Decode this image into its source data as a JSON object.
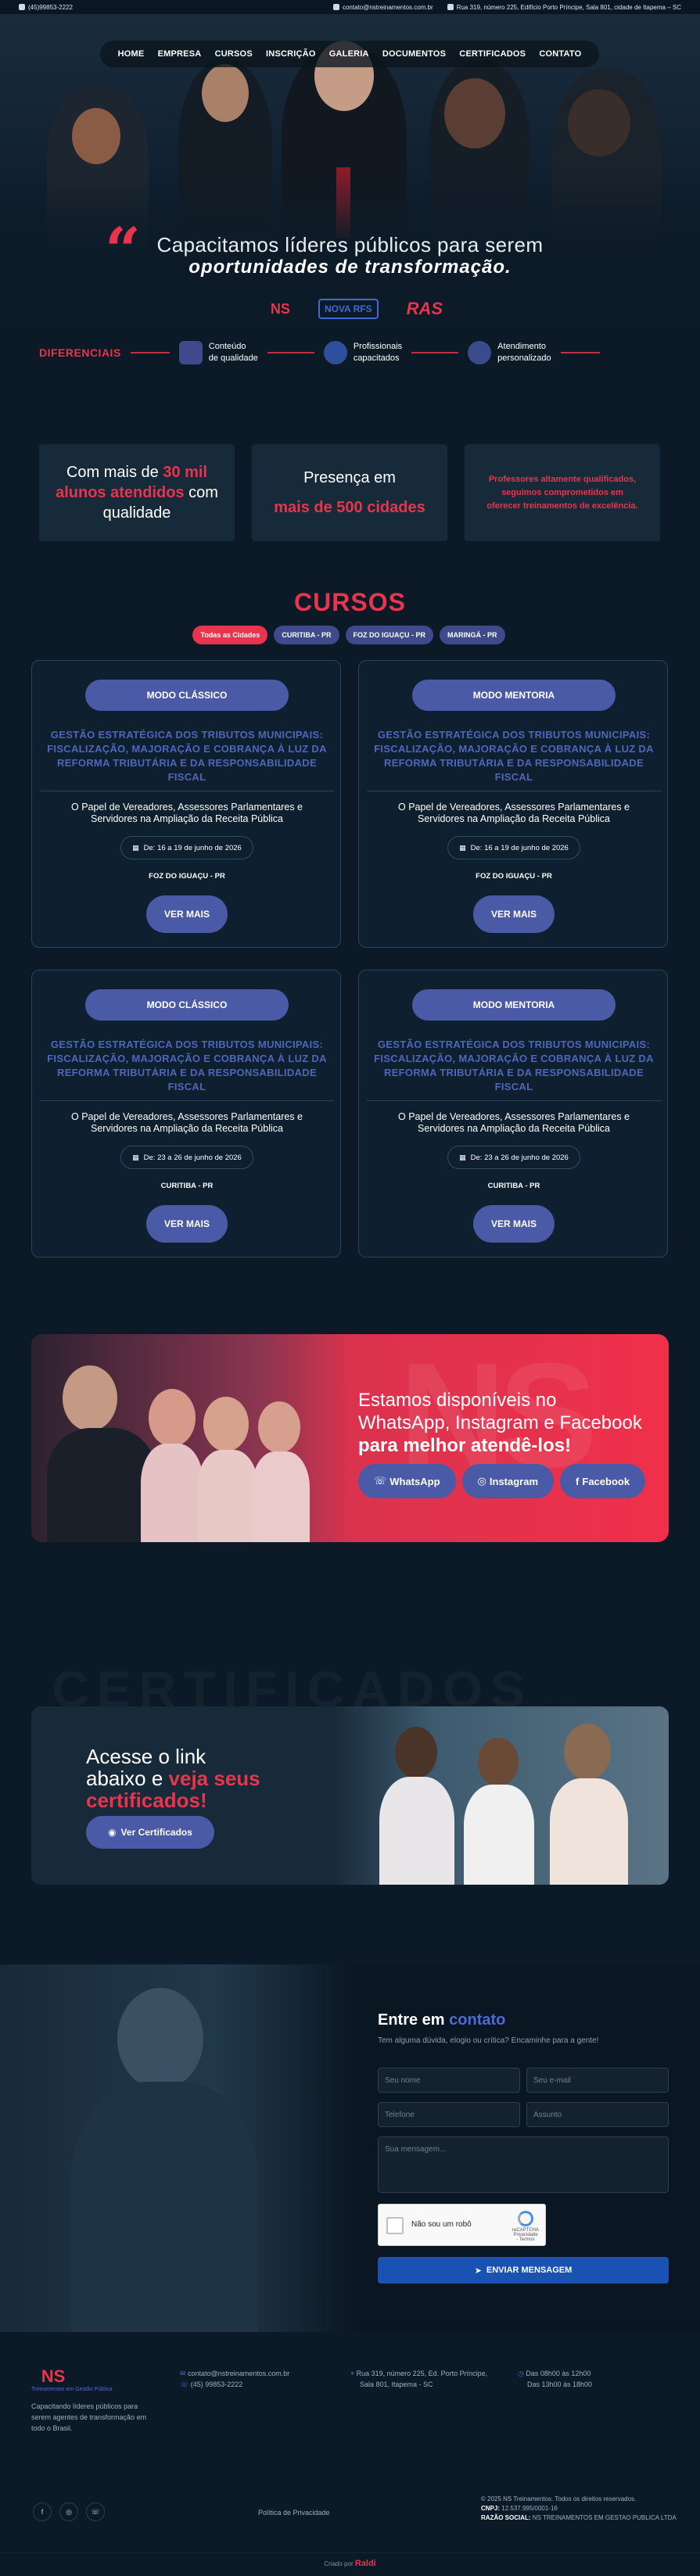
{
  "topbar": {
    "phone": "(45)99853-2222",
    "email": "contato@nstreinamentos.com.br",
    "address": "Rua 319, número 225, Edifício Porto Príncipe, Sala 801, cidade de Itapema – SC"
  },
  "nav": {
    "items": [
      "HOME",
      "EMPRESA",
      "CURSOS",
      "INSCRIÇÃO",
      "GALERIA",
      "DOCUMENTOS",
      "CERTIFICADOS",
      "CONTATO"
    ]
  },
  "hero": {
    "title": "Capacitamos líderes públicos para serem",
    "subtitle": "oportunidades de transformação.",
    "logos": [
      "NS",
      "NOVA RFS",
      "RAS"
    ],
    "diferenciais_title": "DIFERENCIAIS",
    "diferenciais": [
      {
        "line1": "Conteúdo",
        "line2": "de qualidade",
        "icon": "book-icon"
      },
      {
        "line1": "Profissionais",
        "line2": "capacitados",
        "icon": "people-icon"
      },
      {
        "line1": "Atendimento",
        "line2": "personalizado",
        "icon": "support-icon"
      }
    ]
  },
  "stats": [
    {
      "pre": "Com mais de ",
      "highlight": "30 mil alunos atendidos",
      "post": " com qualidade"
    },
    {
      "pre": "Presença em",
      "highlight": "mais de 500 cidades",
      "post": ""
    },
    {
      "highlight": "Professores altamente qualificados, seguimos comprometidos em oferecer treinamentos de excelência."
    }
  ],
  "cursos": {
    "title": "CURSOS",
    "filters": [
      "Todas as Cidades",
      "CURITIBA - PR",
      "FOZ DO IGUAÇU - PR",
      "MARINGÁ - PR"
    ],
    "cards": [
      {
        "mode": "MODO CLÁSSICO",
        "title": "GESTÃO ESTRATÉGICA DOS TRIBUTOS MUNICIPAIS: FISCALIZAÇÃO, MAJORAÇÃO E COBRANÇA À LUZ DA REFORMA TRIBUTÁRIA E DA RESPONSABILIDADE FISCAL",
        "desc": "O Papel de Vereadores, Assessores Parlamentares e Servidores na Ampliação da Receita Pública",
        "date": "De: 16 a 19 de junho de 2026",
        "city": "FOZ DO IGUAÇU - PR",
        "button": "VER MAIS"
      },
      {
        "mode": "MODO MENTORIA",
        "title": "GESTÃO ESTRATÉGICA DOS TRIBUTOS MUNICIPAIS: FISCALIZAÇÃO, MAJORAÇÃO E COBRANÇA À LUZ DA REFORMA TRIBUTÁRIA E DA RESPONSABILIDADE FISCAL",
        "desc": "O Papel de Vereadores, Assessores Parlamentares e Servidores na Ampliação da Receita Pública",
        "date": "De: 16 a 19 de junho de 2026",
        "city": "FOZ DO IGUAÇU - PR",
        "button": "VER MAIS"
      },
      {
        "mode": "MODO CLÁSSICO",
        "title": "GESTÃO ESTRATÉGICA DOS TRIBUTOS MUNICIPAIS: FISCALIZAÇÃO, MAJORAÇÃO E COBRANÇA À LUZ DA REFORMA TRIBUTÁRIA E DA RESPONSABILIDADE FISCAL",
        "desc": "O Papel de Vereadores, Assessores Parlamentares e Servidores na Ampliação da Receita Pública",
        "date": "De: 23 a 26 de junho de 2026",
        "city": "CURITIBA - PR",
        "button": "VER MAIS"
      },
      {
        "mode": "MODO MENTORIA",
        "title": "GESTÃO ESTRATÉGICA DOS TRIBUTOS MUNICIPAIS: FISCALIZAÇÃO, MAJORAÇÃO E COBRANÇA À LUZ DA REFORMA TRIBUTÁRIA E DA RESPONSABILIDADE FISCAL",
        "desc": "O Papel de Vereadores, Assessores Parlamentares e Servidores na Ampliação da Receita Pública",
        "date": "De: 23 a 26 de junho de 2026",
        "city": "CURITIBA - PR",
        "button": "VER MAIS"
      }
    ]
  },
  "social": {
    "watermark": "NS",
    "line1": "Estamos disponíveis no",
    "line2": "WhatsApp, Instagram e Facebook",
    "line3": "para melhor atendê-los!",
    "buttons": [
      "WhatsApp",
      "Instagram",
      "Facebook"
    ]
  },
  "certificados": {
    "watermark": "CERTIFICADOS",
    "line1": "Acesse o link",
    "line2_pre": "abaixo e ",
    "line2_red": "veja seus",
    "line3_red": "certificados!",
    "button": "Ver Certificados"
  },
  "contact": {
    "title_pre": "Entre em ",
    "title_blue": "contato",
    "subtitle": "Tem alguma dúvida, elogio ou crítica? Encaminhe para a gente!",
    "placeholders": {
      "name": "Seu nome",
      "email": "Seu e-mail",
      "phone": "Telefone",
      "subject": "Assunto",
      "message": "Sua mensagem..."
    },
    "captcha_label": "Não sou um robô",
    "captcha_brand": "reCAPTCHA",
    "captcha_terms": "Privacidade - Termos",
    "send": "ENVIAR MENSAGEM"
  },
  "footer": {
    "brand": "NS",
    "brand_sub": "Treinamentos em Gestão Pública",
    "about": "Capacitando líderes públicos para serem agentes de transformação em todo o Brasil.",
    "email": "contato@nstreinamentos.com.br",
    "phone": "(45) 99853-2222",
    "address1": "Rua 319, número 225, Ed. Porto Príncipe,",
    "address2": "Sala 801, Itapema - SC",
    "hours1": "Das 08h00 às 12h00",
    "hours2": "Das 13h00 às 18h00",
    "privacy": "Política de Privacidade",
    "copyright": "© 2025 NS Treinamentos. Todos os direitos reservados.",
    "cnpj_label": "CNPJ:",
    "cnpj": "12.537.995/0001-16",
    "razao_label": "RAZÃO SOCIAL:",
    "razao": "NS TREINAMENTOS EM GESTAO PUBLICA LTDA",
    "credit_pre": "Criado por",
    "credit_brand": "Raldi"
  },
  "colors": {
    "accent_red": "#e8344c",
    "accent_blue": "#4b5aa6",
    "background": "#0b1a26"
  }
}
